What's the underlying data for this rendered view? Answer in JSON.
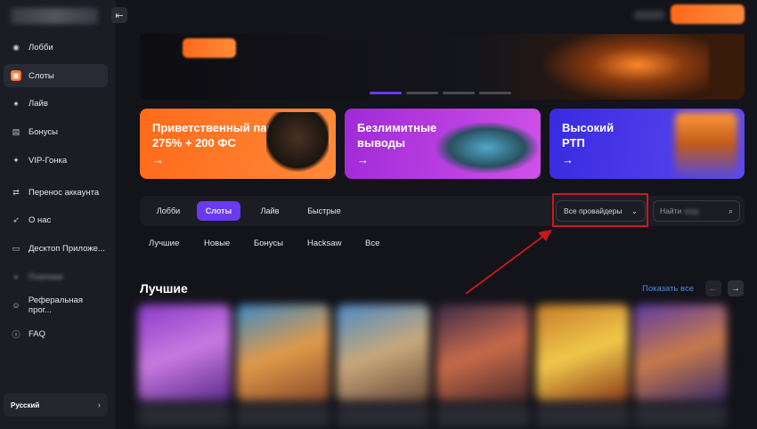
{
  "sidebar": {
    "collapse_icon": "collapse-sidebar-icon",
    "items": [
      {
        "label": "Лобби",
        "icon": "lobby-icon"
      },
      {
        "label": "Слоты",
        "icon": "slots-icon"
      },
      {
        "label": "Лайв",
        "icon": "live-icon"
      },
      {
        "label": "Бонусы",
        "icon": "bonus-icon"
      },
      {
        "label": "VIP-Гонка",
        "icon": "vip-icon"
      },
      {
        "label": "Перенос аккаунта",
        "icon": "transfer-icon"
      },
      {
        "label": "О нас",
        "icon": "rocket-icon"
      },
      {
        "label": "Десктоп Приложе...",
        "icon": "desktop-icon"
      },
      {
        "label": "Платежи",
        "icon": "payments-icon"
      },
      {
        "label": "Реферальная прог...",
        "icon": "referral-icon"
      },
      {
        "label": "FAQ",
        "icon": "info-icon"
      }
    ],
    "language": "Русский"
  },
  "promos": [
    {
      "title_line1": "Приветственный пакет",
      "title_line2": "275% + 200 ФС",
      "arrow": "→"
    },
    {
      "title_line1": "Безлимитные",
      "title_line2": "выводы",
      "arrow": "→"
    },
    {
      "title_line1": "Высокий",
      "title_line2": "РТП",
      "arrow": "→"
    }
  ],
  "filter": {
    "tabs": [
      "Лобби",
      "Слоты",
      "Лайв",
      "Быстрые"
    ],
    "active_tab": "Слоты",
    "providers_label": "Все провайдеры",
    "search_placeholder": "Найти",
    "search_placeholder_blurred": "игру"
  },
  "subfilters": [
    "Лучшие",
    "Новые",
    "Бонусы",
    "Hacksaw",
    "Все"
  ],
  "section": {
    "title": "Лучшие",
    "show_all": "Показать все",
    "prev": "←",
    "next": "→"
  },
  "colors": {
    "accent": "#6a3af0",
    "orange": "#ff6a1a",
    "highlight": "#d01818",
    "link": "#4a8af0"
  }
}
